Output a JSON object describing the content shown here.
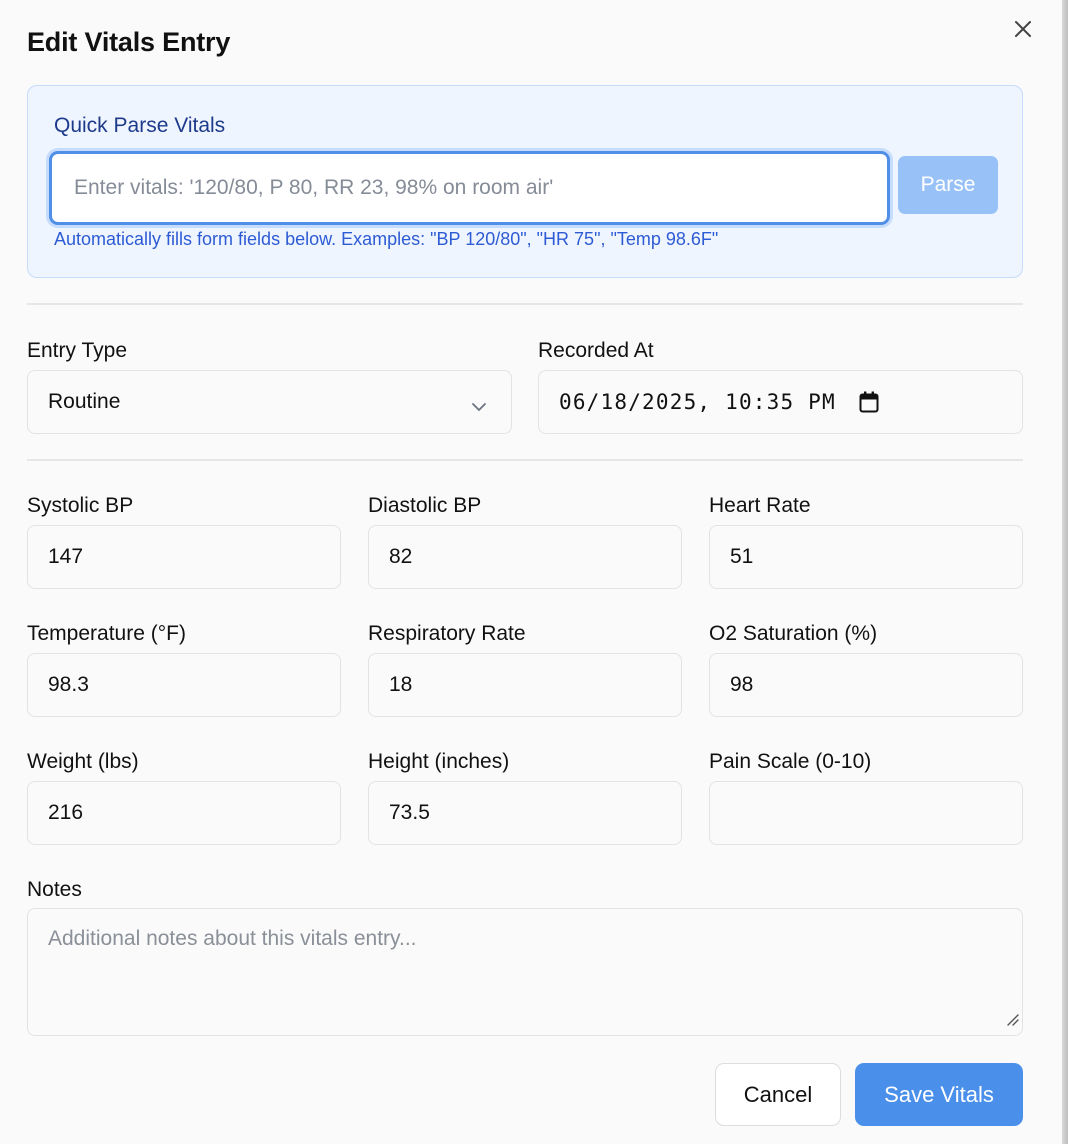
{
  "dialog": {
    "title": "Edit Vitals Entry",
    "close_icon": "close-icon"
  },
  "quick_parse": {
    "label": "Quick Parse Vitals",
    "placeholder": "Enter vitals: '120/80, P 80, RR 23, 98% on room air'",
    "value": "",
    "parse_label": "Parse",
    "help": "Automatically fills form fields below. Examples: \"BP 120/80\", \"HR 75\", \"Temp 98.6F\""
  },
  "entry_type": {
    "label": "Entry Type",
    "value": "Routine"
  },
  "recorded_at": {
    "label": "Recorded At",
    "value": "06/18/2025, 10:35 PM"
  },
  "vitals": {
    "systolic": {
      "label": "Systolic BP",
      "value": "147"
    },
    "diastolic": {
      "label": "Diastolic BP",
      "value": "82"
    },
    "heart_rate": {
      "label": "Heart Rate",
      "value": "51"
    },
    "temperature": {
      "label": "Temperature (°F)",
      "value": "98.3"
    },
    "resp_rate": {
      "label": "Respiratory Rate",
      "value": "18"
    },
    "o2": {
      "label": "O2 Saturation (%)",
      "value": "98"
    },
    "weight": {
      "label": "Weight (lbs)",
      "value": "216"
    },
    "height": {
      "label": "Height (inches)",
      "value": "73.5"
    },
    "pain": {
      "label": "Pain Scale (0-10)",
      "value": ""
    }
  },
  "notes": {
    "label": "Notes",
    "placeholder": "Additional notes about this vitals entry..."
  },
  "actions": {
    "cancel_label": "Cancel",
    "save_label": "Save Vitals"
  },
  "colors": {
    "accent": "#4a90ea",
    "accent_light": "#98c2f7",
    "panel_bg": "#eff5ff"
  }
}
